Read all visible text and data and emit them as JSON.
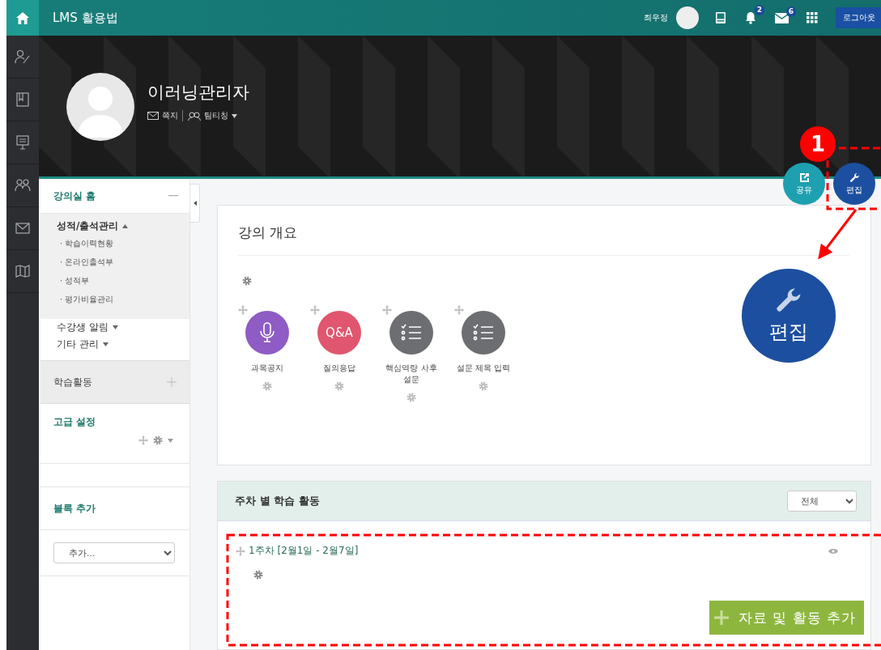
{
  "topbar": {
    "title": "LMS 활용법",
    "user_name": "최우정",
    "notification_count": "2",
    "message_count": "6",
    "logout": "로그아웃"
  },
  "profile": {
    "name": "이러닝관리자",
    "message_link": "쪽지",
    "team_link": "팀티칭"
  },
  "actions": [
    {
      "label": "공유",
      "kind": "share"
    },
    {
      "label": "편집",
      "kind": "edit"
    }
  ],
  "sidebar": {
    "course_home": {
      "title": "강의실 홈",
      "menus": [
        {
          "label": "성적/출석관리",
          "expanded": true,
          "children": [
            {
              "label": "· 학습이력현황"
            },
            {
              "label": "· 온라인출석부"
            },
            {
              "label": "· 성적부"
            },
            {
              "label": "· 평가비율관리"
            }
          ]
        },
        {
          "label": "수강생 알림",
          "expanded": false
        },
        {
          "label": "기타 관리",
          "expanded": false
        }
      ]
    },
    "activities_block": {
      "title": "학습활동"
    },
    "advanced_settings": {
      "title": "고급 설정"
    },
    "add_block": {
      "title": "블록 추가",
      "select": "추가..."
    }
  },
  "overview": {
    "title": "강의 개요",
    "activities": [
      {
        "label": "과목공지",
        "kind": "notice",
        "color": "#8e5cc4"
      },
      {
        "label": "질의응답",
        "kind": "qna",
        "color": "#e0566e",
        "icon_text": "Q&A"
      },
      {
        "label": "핵심역량 사후 설문",
        "kind": "survey",
        "color": "#6d6e72"
      },
      {
        "label": "설문 제목 입력",
        "kind": "survey",
        "color": "#6d6e72"
      }
    ]
  },
  "weekly": {
    "title": "주차 별 학습 활동",
    "filter": "전체",
    "weeks": [
      {
        "title": "1주차 [2월1일 - 2월7일]"
      }
    ],
    "add_button": "자료 및 활동 추가"
  },
  "annotations": {
    "step_badge": "1",
    "callout_label": "편집"
  }
}
